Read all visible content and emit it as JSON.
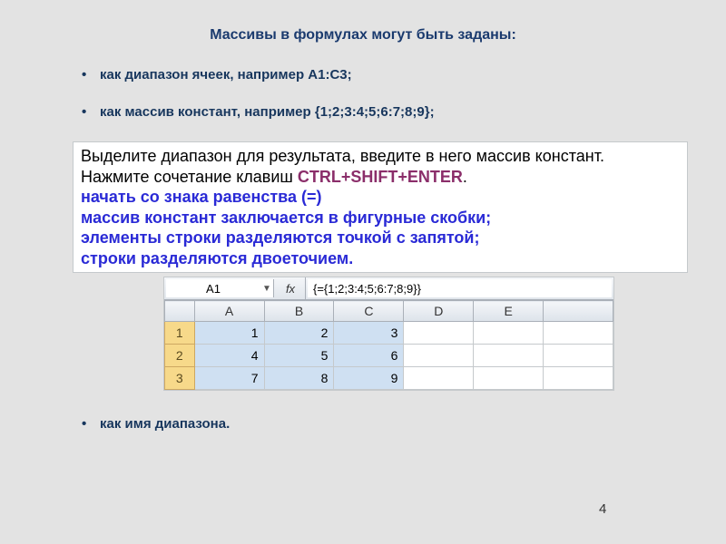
{
  "title": "Массивы в формулах могут быть заданы:",
  "bullets": {
    "b1": "как диапазон ячеек, например А1:С3;",
    "b2": "как массив констант, например {1;2;3:4;5;6:7;8;9};",
    "b3": "как имя диапазона."
  },
  "instruction": {
    "line1": "Выделите диапазон для результата,  введите в него массив констант.",
    "line2_prefix": "Нажмите сочетание клавиш ",
    "combo": "CTRL+SHIFT+ENTER",
    "line2_suffix": ".",
    "blue1": "начать со знака равенства (=)",
    "blue2": "массив констант заключается в фигурные скобки;",
    "blue3": "элементы строки разделяются точкой с запятой;",
    "blue4": "строки разделяются двоеточием."
  },
  "sheet": {
    "namebox": "A1",
    "fx": "fx",
    "formula": "{={1;2;3:4;5;6:7;8;9}}",
    "cols": [
      "A",
      "B",
      "C",
      "D",
      "E"
    ],
    "rows": [
      "1",
      "2",
      "3"
    ],
    "data": [
      [
        "1",
        "2",
        "3",
        "",
        ""
      ],
      [
        "4",
        "5",
        "6",
        "",
        ""
      ],
      [
        "7",
        "8",
        "9",
        "",
        ""
      ]
    ]
  },
  "page": "4"
}
